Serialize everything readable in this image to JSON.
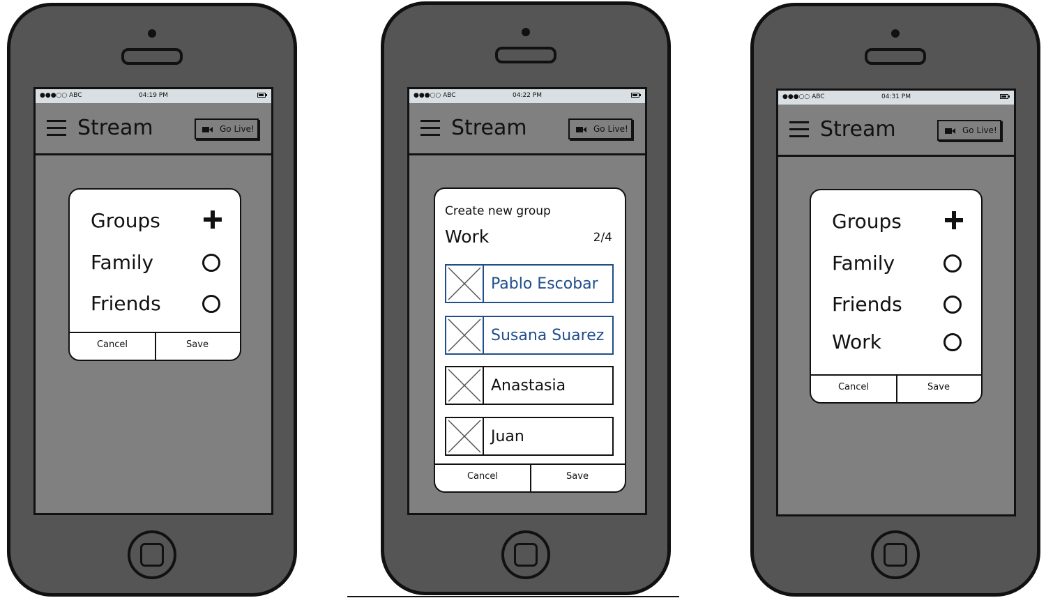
{
  "phones": [
    {
      "status": {
        "carrier": "●●●○○ ABC",
        "time": "04:19 PM"
      },
      "nav": {
        "title": "Stream",
        "go_live": "Go Live!"
      },
      "dialog": {
        "rows": [
          {
            "label": "Groups",
            "icon": "plus-icon"
          },
          {
            "label": "Family",
            "icon": "radio-empty-icon"
          },
          {
            "label": "Friends",
            "icon": "radio-empty-icon"
          }
        ],
        "cancel": "Cancel",
        "save": "Save"
      }
    },
    {
      "status": {
        "carrier": "●●●○○ ABC",
        "time": "04:22 PM"
      },
      "nav": {
        "title": "Stream",
        "go_live": "Go Live!"
      },
      "dialog": {
        "heading": "Create new group",
        "name": "Work",
        "count": "2/4",
        "members": [
          {
            "name": "Pablo Escobar",
            "selected": true
          },
          {
            "name": "Susana Suarez",
            "selected": true
          },
          {
            "name": "Anastasia",
            "selected": false
          },
          {
            "name": "Juan",
            "selected": false
          }
        ],
        "cancel": "Cancel",
        "save": "Save"
      }
    },
    {
      "status": {
        "carrier": "●●●○○ ABC",
        "time": "04:31 PM"
      },
      "nav": {
        "title": "Stream",
        "go_live": "Go Live!"
      },
      "dialog": {
        "rows": [
          {
            "label": "Groups",
            "icon": "plus-icon"
          },
          {
            "label": "Family",
            "icon": "radio-empty-icon"
          },
          {
            "label": "Friends",
            "icon": "radio-empty-icon"
          },
          {
            "label": "Work",
            "icon": "radio-empty-icon"
          }
        ],
        "cancel": "Cancel",
        "save": "Save"
      }
    }
  ],
  "colors": {
    "selected": "#1f4e8c",
    "screen": "#808080",
    "body": "#555555"
  }
}
